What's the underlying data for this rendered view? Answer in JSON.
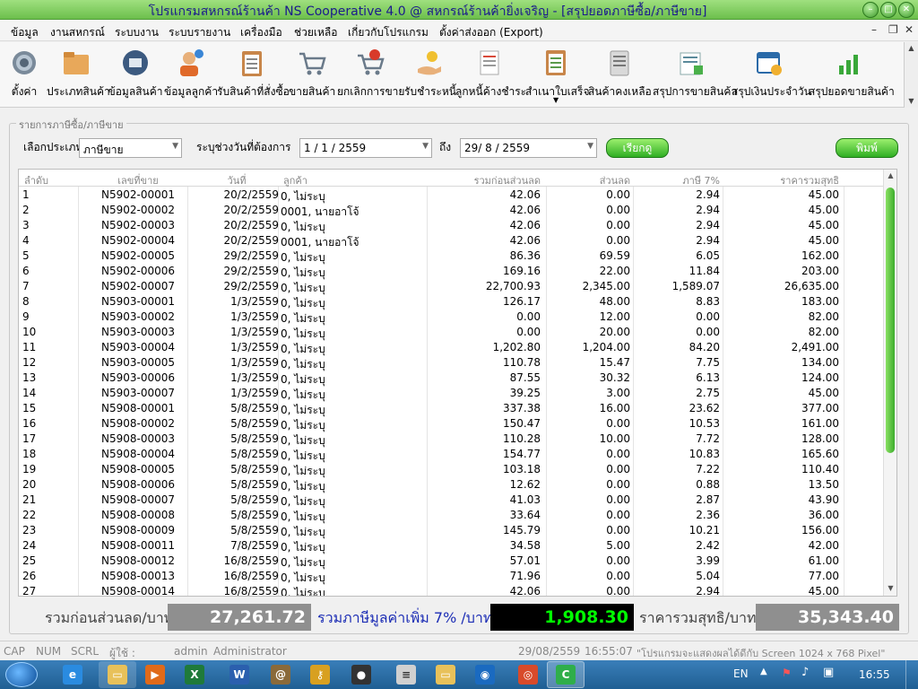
{
  "window": {
    "title": "โปรแกรมสหกรณ์ร้านค้า NS Cooperative 4.0 @ สหกรณ์ร้านค้ายิ่งเจริญ - [สรุปยอดภาษีซื้อ/ภาษีขาย]"
  },
  "menu": [
    "ข้อมูล",
    "งานสหกรณ์",
    "ระบบงาน",
    "ระบบรายงาน",
    "เครื่องมือ",
    "ช่วยเหลือ",
    "เกี่ยวกับโปรแกรม",
    "ตั้งค่าส่งออก (Export)"
  ],
  "toolbar": [
    {
      "label": "ตั้งค่า",
      "icon": "gear-icon"
    },
    {
      "label": "ประเภทสินค้า",
      "icon": "folder-icon"
    },
    {
      "label": "ข้อมูลสินค้า",
      "icon": "product-search-icon"
    },
    {
      "label": "ข้อมูลลูกค้า",
      "icon": "customer-icon"
    },
    {
      "label": "รับสินค้าที่สั่งซื้อ",
      "icon": "clipboard-icon"
    },
    {
      "label": "ขายสินค้า",
      "icon": "cart-icon"
    },
    {
      "label": "ยกเลิกการขาย",
      "icon": "cart-cancel-icon"
    },
    {
      "label": "รับชำระหนี้",
      "icon": "payment-icon"
    },
    {
      "label": "ลูกหนี้ค้างชำระ",
      "icon": "invoice-icon"
    },
    {
      "label": "สำเนาใบเสร็จ",
      "icon": "receipt-copy-icon"
    },
    {
      "label": "สินค้าคงเหลือ",
      "icon": "inventory-icon"
    },
    {
      "label": "สรุปการขายสินค้า",
      "icon": "sales-summary-icon"
    },
    {
      "label": "สรุปเงินประจำวัน",
      "icon": "daily-cash-icon"
    },
    {
      "label": "สรุปยอดขายสินค้า",
      "icon": "sales-chart-icon"
    }
  ],
  "filter": {
    "group_title": "รายการภาษีซื้อ/ภาษีขาย",
    "type_label": "เลือกประเภท",
    "type_value": "ภาษีขาย",
    "range_label": "ระบุช่วงวันที่ต้องการ",
    "from_date": "1 / 1 / 2559",
    "to_label": "ถึง",
    "to_date": "29/ 8 / 2559",
    "search_button": "เรียกดู",
    "print_button": "พิมพ์"
  },
  "table": {
    "headers": [
      "ลำดับ",
      "เลขที่ขาย",
      "วันที่",
      "ลูกค้า",
      "รวมก่อนส่วนลด",
      "ส่วนลด",
      "ภาษี 7%",
      "ราคารวมสุทธิ"
    ],
    "rows": [
      [
        "1",
        "N5902-00001",
        "20/2/2559",
        "0, ไม่ระบุ",
        "42.06",
        "0.00",
        "2.94",
        "45.00"
      ],
      [
        "2",
        "N5902-00002",
        "20/2/2559",
        "0001, นายอาโจ้",
        "42.06",
        "0.00",
        "2.94",
        "45.00"
      ],
      [
        "3",
        "N5902-00003",
        "20/2/2559",
        "0, ไม่ระบุ",
        "42.06",
        "0.00",
        "2.94",
        "45.00"
      ],
      [
        "4",
        "N5902-00004",
        "20/2/2559",
        "0001, นายอาโจ้",
        "42.06",
        "0.00",
        "2.94",
        "45.00"
      ],
      [
        "5",
        "N5902-00005",
        "29/2/2559",
        "0, ไม่ระบุ",
        "86.36",
        "69.59",
        "6.05",
        "162.00"
      ],
      [
        "6",
        "N5902-00006",
        "29/2/2559",
        "0, ไม่ระบุ",
        "169.16",
        "22.00",
        "11.84",
        "203.00"
      ],
      [
        "7",
        "N5902-00007",
        "29/2/2559",
        "0, ไม่ระบุ",
        "22,700.93",
        "2,345.00",
        "1,589.07",
        "26,635.00"
      ],
      [
        "8",
        "N5903-00001",
        "1/3/2559",
        "0, ไม่ระบุ",
        "126.17",
        "48.00",
        "8.83",
        "183.00"
      ],
      [
        "9",
        "N5903-00002",
        "1/3/2559",
        "0, ไม่ระบุ",
        "0.00",
        "12.00",
        "0.00",
        "82.00"
      ],
      [
        "10",
        "N5903-00003",
        "1/3/2559",
        "0, ไม่ระบุ",
        "0.00",
        "20.00",
        "0.00",
        "82.00"
      ],
      [
        "11",
        "N5903-00004",
        "1/3/2559",
        "0, ไม่ระบุ",
        "1,202.80",
        "1,204.00",
        "84.20",
        "2,491.00"
      ],
      [
        "12",
        "N5903-00005",
        "1/3/2559",
        "0, ไม่ระบุ",
        "110.78",
        "15.47",
        "7.75",
        "134.00"
      ],
      [
        "13",
        "N5903-00006",
        "1/3/2559",
        "0, ไม่ระบุ",
        "87.55",
        "30.32",
        "6.13",
        "124.00"
      ],
      [
        "14",
        "N5903-00007",
        "1/3/2559",
        "0, ไม่ระบุ",
        "39.25",
        "3.00",
        "2.75",
        "45.00"
      ],
      [
        "15",
        "N5908-00001",
        "5/8/2559",
        "0, ไม่ระบุ",
        "337.38",
        "16.00",
        "23.62",
        "377.00"
      ],
      [
        "16",
        "N5908-00002",
        "5/8/2559",
        "0, ไม่ระบุ",
        "150.47",
        "0.00",
        "10.53",
        "161.00"
      ],
      [
        "17",
        "N5908-00003",
        "5/8/2559",
        "0, ไม่ระบุ",
        "110.28",
        "10.00",
        "7.72",
        "128.00"
      ],
      [
        "18",
        "N5908-00004",
        "5/8/2559",
        "0, ไม่ระบุ",
        "154.77",
        "0.00",
        "10.83",
        "165.60"
      ],
      [
        "19",
        "N5908-00005",
        "5/8/2559",
        "0, ไม่ระบุ",
        "103.18",
        "0.00",
        "7.22",
        "110.40"
      ],
      [
        "20",
        "N5908-00006",
        "5/8/2559",
        "0, ไม่ระบุ",
        "12.62",
        "0.00",
        "0.88",
        "13.50"
      ],
      [
        "21",
        "N5908-00007",
        "5/8/2559",
        "0, ไม่ระบุ",
        "41.03",
        "0.00",
        "2.87",
        "43.90"
      ],
      [
        "22",
        "N5908-00008",
        "5/8/2559",
        "0, ไม่ระบุ",
        "33.64",
        "0.00",
        "2.36",
        "36.00"
      ],
      [
        "23",
        "N5908-00009",
        "5/8/2559",
        "0, ไม่ระบุ",
        "145.79",
        "0.00",
        "10.21",
        "156.00"
      ],
      [
        "24",
        "N5908-00011",
        "7/8/2559",
        "0, ไม่ระบุ",
        "34.58",
        "5.00",
        "2.42",
        "42.00"
      ],
      [
        "25",
        "N5908-00012",
        "16/8/2559",
        "0, ไม่ระบุ",
        "57.01",
        "0.00",
        "3.99",
        "61.00"
      ],
      [
        "26",
        "N5908-00013",
        "16/8/2559",
        "0, ไม่ระบุ",
        "71.96",
        "0.00",
        "5.04",
        "77.00"
      ],
      [
        "27",
        "N5908-00014",
        "16/8/2559",
        "0, ไม่ระบุ",
        "42.06",
        "0.00",
        "2.94",
        "45.00"
      ]
    ]
  },
  "totals": {
    "before_label": "รวมก่อนส่วนลด/บาท",
    "before_value": "27,261.72",
    "vat_label": "รวมภาษีมูลค่าเพิ่ม 7% /บาท",
    "vat_value": "1,908.30",
    "net_label": "ราคารวมสุทธิ/บาท",
    "net_value": "35,343.40"
  },
  "statusbar": {
    "cap": "CAP",
    "num": "NUM",
    "scrl": "SCRL",
    "user_label": "ผู้ใช้ :",
    "user_id": "admin",
    "user_name": "Administrator",
    "date": "29/08/2559",
    "time": "16:55:07",
    "message": "\"โปรแกรมจะแสดงผลได้ดีกับ  Screen 1024 x 768 Pixel\""
  },
  "taskbar": {
    "lang": "EN",
    "clock": "16:55"
  },
  "colors": {
    "title_green": "#6cbf4c",
    "button_green": "#2fae23",
    "vat_total_text": "#00ff00",
    "total_box_gray": "#8f8f8f"
  }
}
